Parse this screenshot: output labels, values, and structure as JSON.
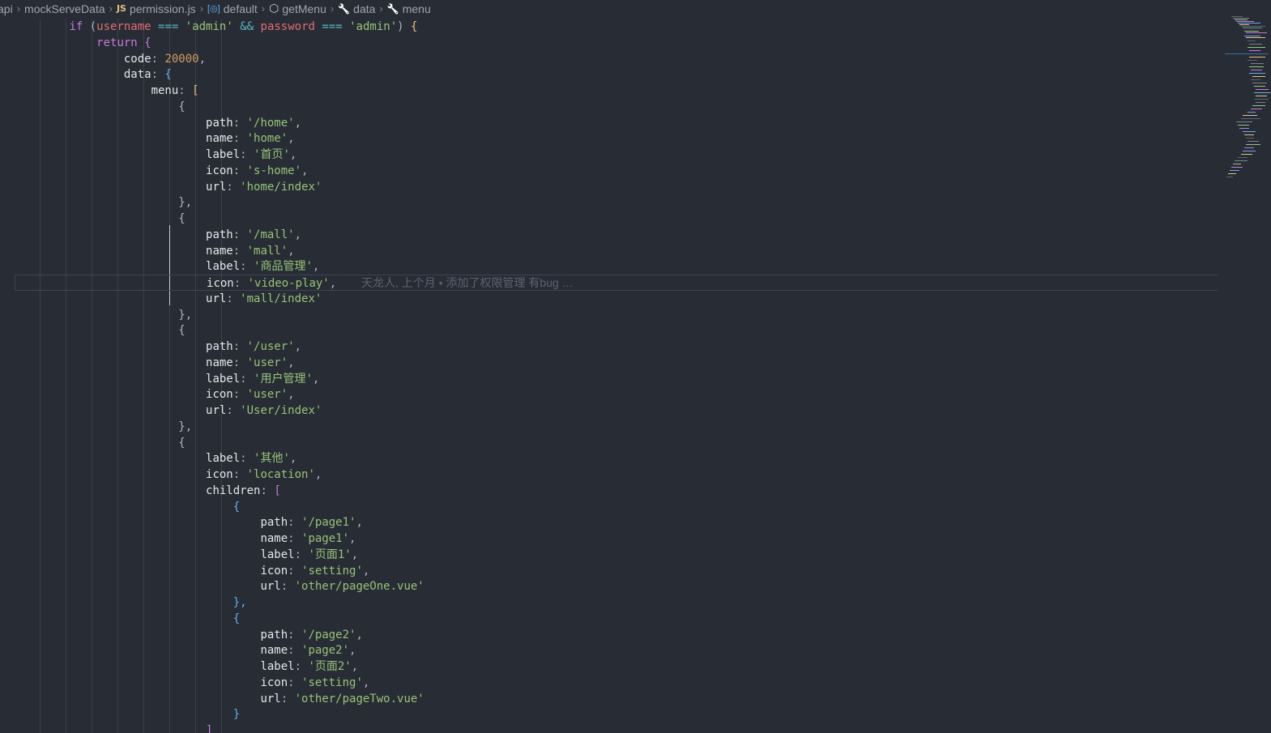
{
  "breadcrumb": {
    "items": [
      {
        "label": "api",
        "icon": null
      },
      {
        "label": "mockServeData",
        "icon": null
      },
      {
        "label": "permission.js",
        "icon": "js-file-icon",
        "icon_text": "JS"
      },
      {
        "label": "default",
        "icon": "variable-icon",
        "icon_text": "[◎]"
      },
      {
        "label": "getMenu",
        "icon": "cube-icon",
        "icon_text": "⬡"
      },
      {
        "label": "data",
        "icon": "wrench-icon",
        "icon_text": "🔧"
      },
      {
        "label": "menu",
        "icon": "wrench-icon",
        "icon_text": "🔧"
      }
    ],
    "separator": "›"
  },
  "editor": {
    "current_line_index": 16,
    "lines": [
      {
        "indent": 8,
        "tokens": [
          [
            "kw",
            "if"
          ],
          [
            "pun",
            " ("
          ],
          [
            "var",
            "username"
          ],
          [
            "pun",
            " "
          ],
          [
            "op",
            "==="
          ],
          [
            "pun",
            " "
          ],
          [
            "str",
            "'admin'"
          ],
          [
            "pun",
            " "
          ],
          [
            "op",
            "&&"
          ],
          [
            "pun",
            " "
          ],
          [
            "var",
            "password"
          ],
          [
            "pun",
            " "
          ],
          [
            "op",
            "==="
          ],
          [
            "pun",
            " "
          ],
          [
            "str",
            "'admin'"
          ],
          [
            "pun",
            ") "
          ],
          [
            "b1",
            "{"
          ]
        ]
      },
      {
        "indent": 12,
        "tokens": [
          [
            "kw",
            "return"
          ],
          [
            "pun",
            " "
          ],
          [
            "b2",
            "{"
          ]
        ]
      },
      {
        "indent": 16,
        "tokens": [
          [
            "prop",
            "code"
          ],
          [
            "pun",
            ": "
          ],
          [
            "num",
            "20000"
          ],
          [
            "pun",
            ","
          ]
        ]
      },
      {
        "indent": 16,
        "tokens": [
          [
            "prop",
            "data"
          ],
          [
            "pun",
            ": "
          ],
          [
            "b3",
            "{"
          ]
        ]
      },
      {
        "indent": 20,
        "tokens": [
          [
            "prop",
            "menu"
          ],
          [
            "pun",
            ": "
          ],
          [
            "b1",
            "["
          ]
        ]
      },
      {
        "indent": 24,
        "tokens": [
          [
            "pun",
            "{"
          ]
        ]
      },
      {
        "indent": 28,
        "tokens": [
          [
            "prop",
            "path"
          ],
          [
            "pun",
            ": "
          ],
          [
            "str",
            "'/home'"
          ],
          [
            "pun",
            ","
          ]
        ]
      },
      {
        "indent": 28,
        "tokens": [
          [
            "prop",
            "name"
          ],
          [
            "pun",
            ": "
          ],
          [
            "str",
            "'home'"
          ],
          [
            "pun",
            ","
          ]
        ]
      },
      {
        "indent": 28,
        "tokens": [
          [
            "prop",
            "label"
          ],
          [
            "pun",
            ": "
          ],
          [
            "str",
            "'首页'"
          ],
          [
            "pun",
            ","
          ]
        ]
      },
      {
        "indent": 28,
        "tokens": [
          [
            "prop",
            "icon"
          ],
          [
            "pun",
            ": "
          ],
          [
            "str",
            "'s-home'"
          ],
          [
            "pun",
            ","
          ]
        ]
      },
      {
        "indent": 28,
        "tokens": [
          [
            "prop",
            "url"
          ],
          [
            "pun",
            ": "
          ],
          [
            "str",
            "'home/index'"
          ]
        ]
      },
      {
        "indent": 24,
        "tokens": [
          [
            "pun",
            "},"
          ]
        ]
      },
      {
        "indent": 24,
        "tokens": [
          [
            "pun",
            "{"
          ]
        ]
      },
      {
        "indent": 28,
        "tokens": [
          [
            "prop",
            "path"
          ],
          [
            "pun",
            ": "
          ],
          [
            "str",
            "'/mall'"
          ],
          [
            "pun",
            ","
          ]
        ]
      },
      {
        "indent": 28,
        "tokens": [
          [
            "prop",
            "name"
          ],
          [
            "pun",
            ": "
          ],
          [
            "str",
            "'mall'"
          ],
          [
            "pun",
            ","
          ]
        ]
      },
      {
        "indent": 28,
        "tokens": [
          [
            "prop",
            "label"
          ],
          [
            "pun",
            ": "
          ],
          [
            "str",
            "'商品管理'"
          ],
          [
            "pun",
            ","
          ]
        ]
      },
      {
        "indent": 28,
        "tokens": [
          [
            "prop",
            "icon"
          ],
          [
            "pun",
            ": "
          ],
          [
            "str",
            "'video-play'"
          ],
          [
            "pun",
            ","
          ]
        ]
      },
      {
        "indent": 28,
        "tokens": [
          [
            "prop",
            "url"
          ],
          [
            "pun",
            ": "
          ],
          [
            "str",
            "'mall/index'"
          ]
        ]
      },
      {
        "indent": 24,
        "tokens": [
          [
            "pun",
            "},"
          ]
        ]
      },
      {
        "indent": 24,
        "tokens": [
          [
            "pun",
            "{"
          ]
        ]
      },
      {
        "indent": 28,
        "tokens": [
          [
            "prop",
            "path"
          ],
          [
            "pun",
            ": "
          ],
          [
            "str",
            "'/user'"
          ],
          [
            "pun",
            ","
          ]
        ]
      },
      {
        "indent": 28,
        "tokens": [
          [
            "prop",
            "name"
          ],
          [
            "pun",
            ": "
          ],
          [
            "str",
            "'user'"
          ],
          [
            "pun",
            ","
          ]
        ]
      },
      {
        "indent": 28,
        "tokens": [
          [
            "prop",
            "label"
          ],
          [
            "pun",
            ": "
          ],
          [
            "str",
            "'用户管理'"
          ],
          [
            "pun",
            ","
          ]
        ]
      },
      {
        "indent": 28,
        "tokens": [
          [
            "prop",
            "icon"
          ],
          [
            "pun",
            ": "
          ],
          [
            "str",
            "'user'"
          ],
          [
            "pun",
            ","
          ]
        ]
      },
      {
        "indent": 28,
        "tokens": [
          [
            "prop",
            "url"
          ],
          [
            "pun",
            ": "
          ],
          [
            "str",
            "'User/index'"
          ]
        ]
      },
      {
        "indent": 24,
        "tokens": [
          [
            "pun",
            "},"
          ]
        ]
      },
      {
        "indent": 24,
        "tokens": [
          [
            "pun",
            "{"
          ]
        ]
      },
      {
        "indent": 28,
        "tokens": [
          [
            "prop",
            "label"
          ],
          [
            "pun",
            ": "
          ],
          [
            "str",
            "'其他'"
          ],
          [
            "pun",
            ","
          ]
        ]
      },
      {
        "indent": 28,
        "tokens": [
          [
            "prop",
            "icon"
          ],
          [
            "pun",
            ": "
          ],
          [
            "str",
            "'location'"
          ],
          [
            "pun",
            ","
          ]
        ]
      },
      {
        "indent": 28,
        "tokens": [
          [
            "prop",
            "children"
          ],
          [
            "pun",
            ": "
          ],
          [
            "b2",
            "["
          ]
        ]
      },
      {
        "indent": 32,
        "tokens": [
          [
            "b3",
            "{"
          ]
        ]
      },
      {
        "indent": 36,
        "tokens": [
          [
            "prop",
            "path"
          ],
          [
            "pun",
            ": "
          ],
          [
            "str",
            "'/page1'"
          ],
          [
            "pun",
            ","
          ]
        ]
      },
      {
        "indent": 36,
        "tokens": [
          [
            "prop",
            "name"
          ],
          [
            "pun",
            ": "
          ],
          [
            "str",
            "'page1'"
          ],
          [
            "pun",
            ","
          ]
        ]
      },
      {
        "indent": 36,
        "tokens": [
          [
            "prop",
            "label"
          ],
          [
            "pun",
            ": "
          ],
          [
            "str",
            "'页面1'"
          ],
          [
            "pun",
            ","
          ]
        ]
      },
      {
        "indent": 36,
        "tokens": [
          [
            "prop",
            "icon"
          ],
          [
            "pun",
            ": "
          ],
          [
            "str",
            "'setting'"
          ],
          [
            "pun",
            ","
          ]
        ]
      },
      {
        "indent": 36,
        "tokens": [
          [
            "prop",
            "url"
          ],
          [
            "pun",
            ": "
          ],
          [
            "str",
            "'other/pageOne.vue'"
          ]
        ]
      },
      {
        "indent": 32,
        "tokens": [
          [
            "b3",
            "},"
          ]
        ]
      },
      {
        "indent": 32,
        "tokens": [
          [
            "b3",
            "{"
          ]
        ]
      },
      {
        "indent": 36,
        "tokens": [
          [
            "prop",
            "path"
          ],
          [
            "pun",
            ": "
          ],
          [
            "str",
            "'/page2'"
          ],
          [
            "pun",
            ","
          ]
        ]
      },
      {
        "indent": 36,
        "tokens": [
          [
            "prop",
            "name"
          ],
          [
            "pun",
            ": "
          ],
          [
            "str",
            "'page2'"
          ],
          [
            "pun",
            ","
          ]
        ]
      },
      {
        "indent": 36,
        "tokens": [
          [
            "prop",
            "label"
          ],
          [
            "pun",
            ": "
          ],
          [
            "str",
            "'页面2'"
          ],
          [
            "pun",
            ","
          ]
        ]
      },
      {
        "indent": 36,
        "tokens": [
          [
            "prop",
            "icon"
          ],
          [
            "pun",
            ": "
          ],
          [
            "str",
            "'setting'"
          ],
          [
            "pun",
            ","
          ]
        ]
      },
      {
        "indent": 36,
        "tokens": [
          [
            "prop",
            "url"
          ],
          [
            "pun",
            ": "
          ],
          [
            "str",
            "'other/pageTwo.vue'"
          ]
        ]
      },
      {
        "indent": 32,
        "tokens": [
          [
            "b3",
            "}"
          ]
        ]
      },
      {
        "indent": 28,
        "tokens": [
          [
            "b2",
            "]"
          ]
        ]
      }
    ],
    "blame": "天龙人, 上个月 • 添加了权限管理 有bug …"
  },
  "colors": {
    "background": "#282c34",
    "keyword": "#c678dd",
    "variable": "#e06c75",
    "string": "#98c379",
    "number": "#d19a66",
    "operator": "#56b6c2",
    "bracket_gold": "#e5c07b",
    "bracket_purple": "#c678dd",
    "bracket_blue": "#61afef"
  }
}
